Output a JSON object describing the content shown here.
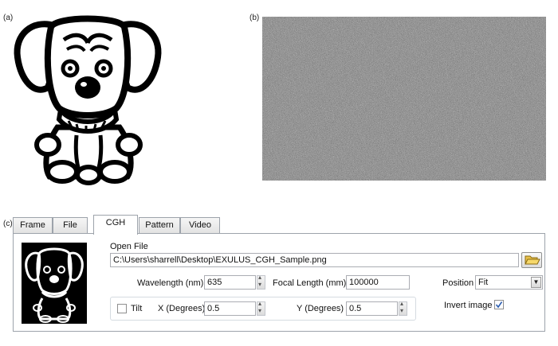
{
  "panels": {
    "a_label": "(a)",
    "b_label": "(b)",
    "c_label": "(c)"
  },
  "tabs": [
    {
      "label": "Frame",
      "active": false
    },
    {
      "label": "File",
      "active": false
    },
    {
      "label": "CGH",
      "active": true
    },
    {
      "label": "Pattern",
      "active": false
    },
    {
      "label": "Video",
      "active": false
    }
  ],
  "cgh": {
    "open_file_label": "Open File",
    "file_path": "C:\\Users\\sharrell\\Desktop\\EXULUS_CGH_Sample.png",
    "wavelength_label": "Wavelength (nm)",
    "wavelength_value": "635",
    "focal_length_label": "Focal Length (mm)",
    "focal_length_value": "100000",
    "position_label": "Position",
    "position_value": "Fit",
    "tilt_label": "Tilt",
    "tilt_checked": false,
    "x_label": "X (Degrees)",
    "x_value": "0.5",
    "y_label": "Y (Degrees)",
    "y_value": "0.5",
    "invert_label": "Invert image",
    "invert_checked": true
  },
  "icons": {
    "folder": "folder-open-icon",
    "spin": "spin-arrows-icon",
    "dropdown": "chevron-down-icon",
    "check": "checkmark-icon"
  },
  "colors": {
    "tab_border": "#9da3ab",
    "noise_base": "#7a7a7a",
    "check": "#2a5db0"
  }
}
